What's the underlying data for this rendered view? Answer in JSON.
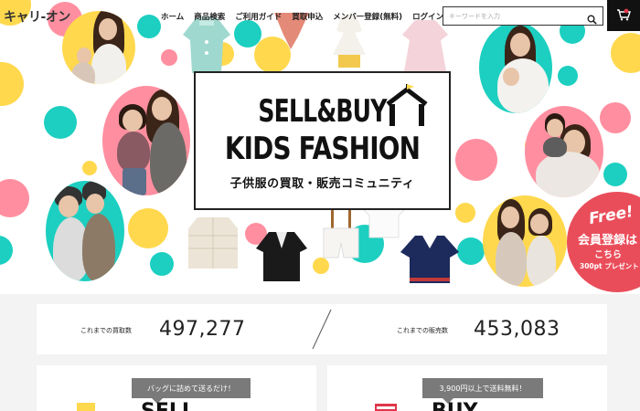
{
  "header": {
    "logo": "キャリ-オン",
    "nav": [
      "ホーム",
      "商品検索",
      "ご利用ガイド",
      "買取申込",
      "メンバー登録(無料)",
      "ログイン"
    ],
    "search_placeholder": "キーワードを入力"
  },
  "hero": {
    "title_line1": "SELL&BUY",
    "title_line2": "KIDS FASHION",
    "subtitle": "子供服の買取・販売コミュニティ",
    "badge": {
      "free": "Free!",
      "line1": "会員登録は",
      "line2": "こちら",
      "line3": "300pt プレゼント"
    }
  },
  "stats": {
    "buy_label": "これまでの買取数",
    "buy_value": "497,277",
    "sell_label": "これまでの販売数",
    "sell_value": "453,083"
  },
  "cards": {
    "sell_tag": "バッグに詰めて送るだけ！",
    "sell_title": "SELL",
    "buy_tag": "3,900円以上で送料無料！",
    "buy_title": "BUY"
  },
  "colors": {
    "teal": "#1ccfc0",
    "pink": "#ff8fa0",
    "yellow": "#ffd84d",
    "badge_red": "#ea4d5a",
    "tag_gray": "#7a7a7a"
  }
}
